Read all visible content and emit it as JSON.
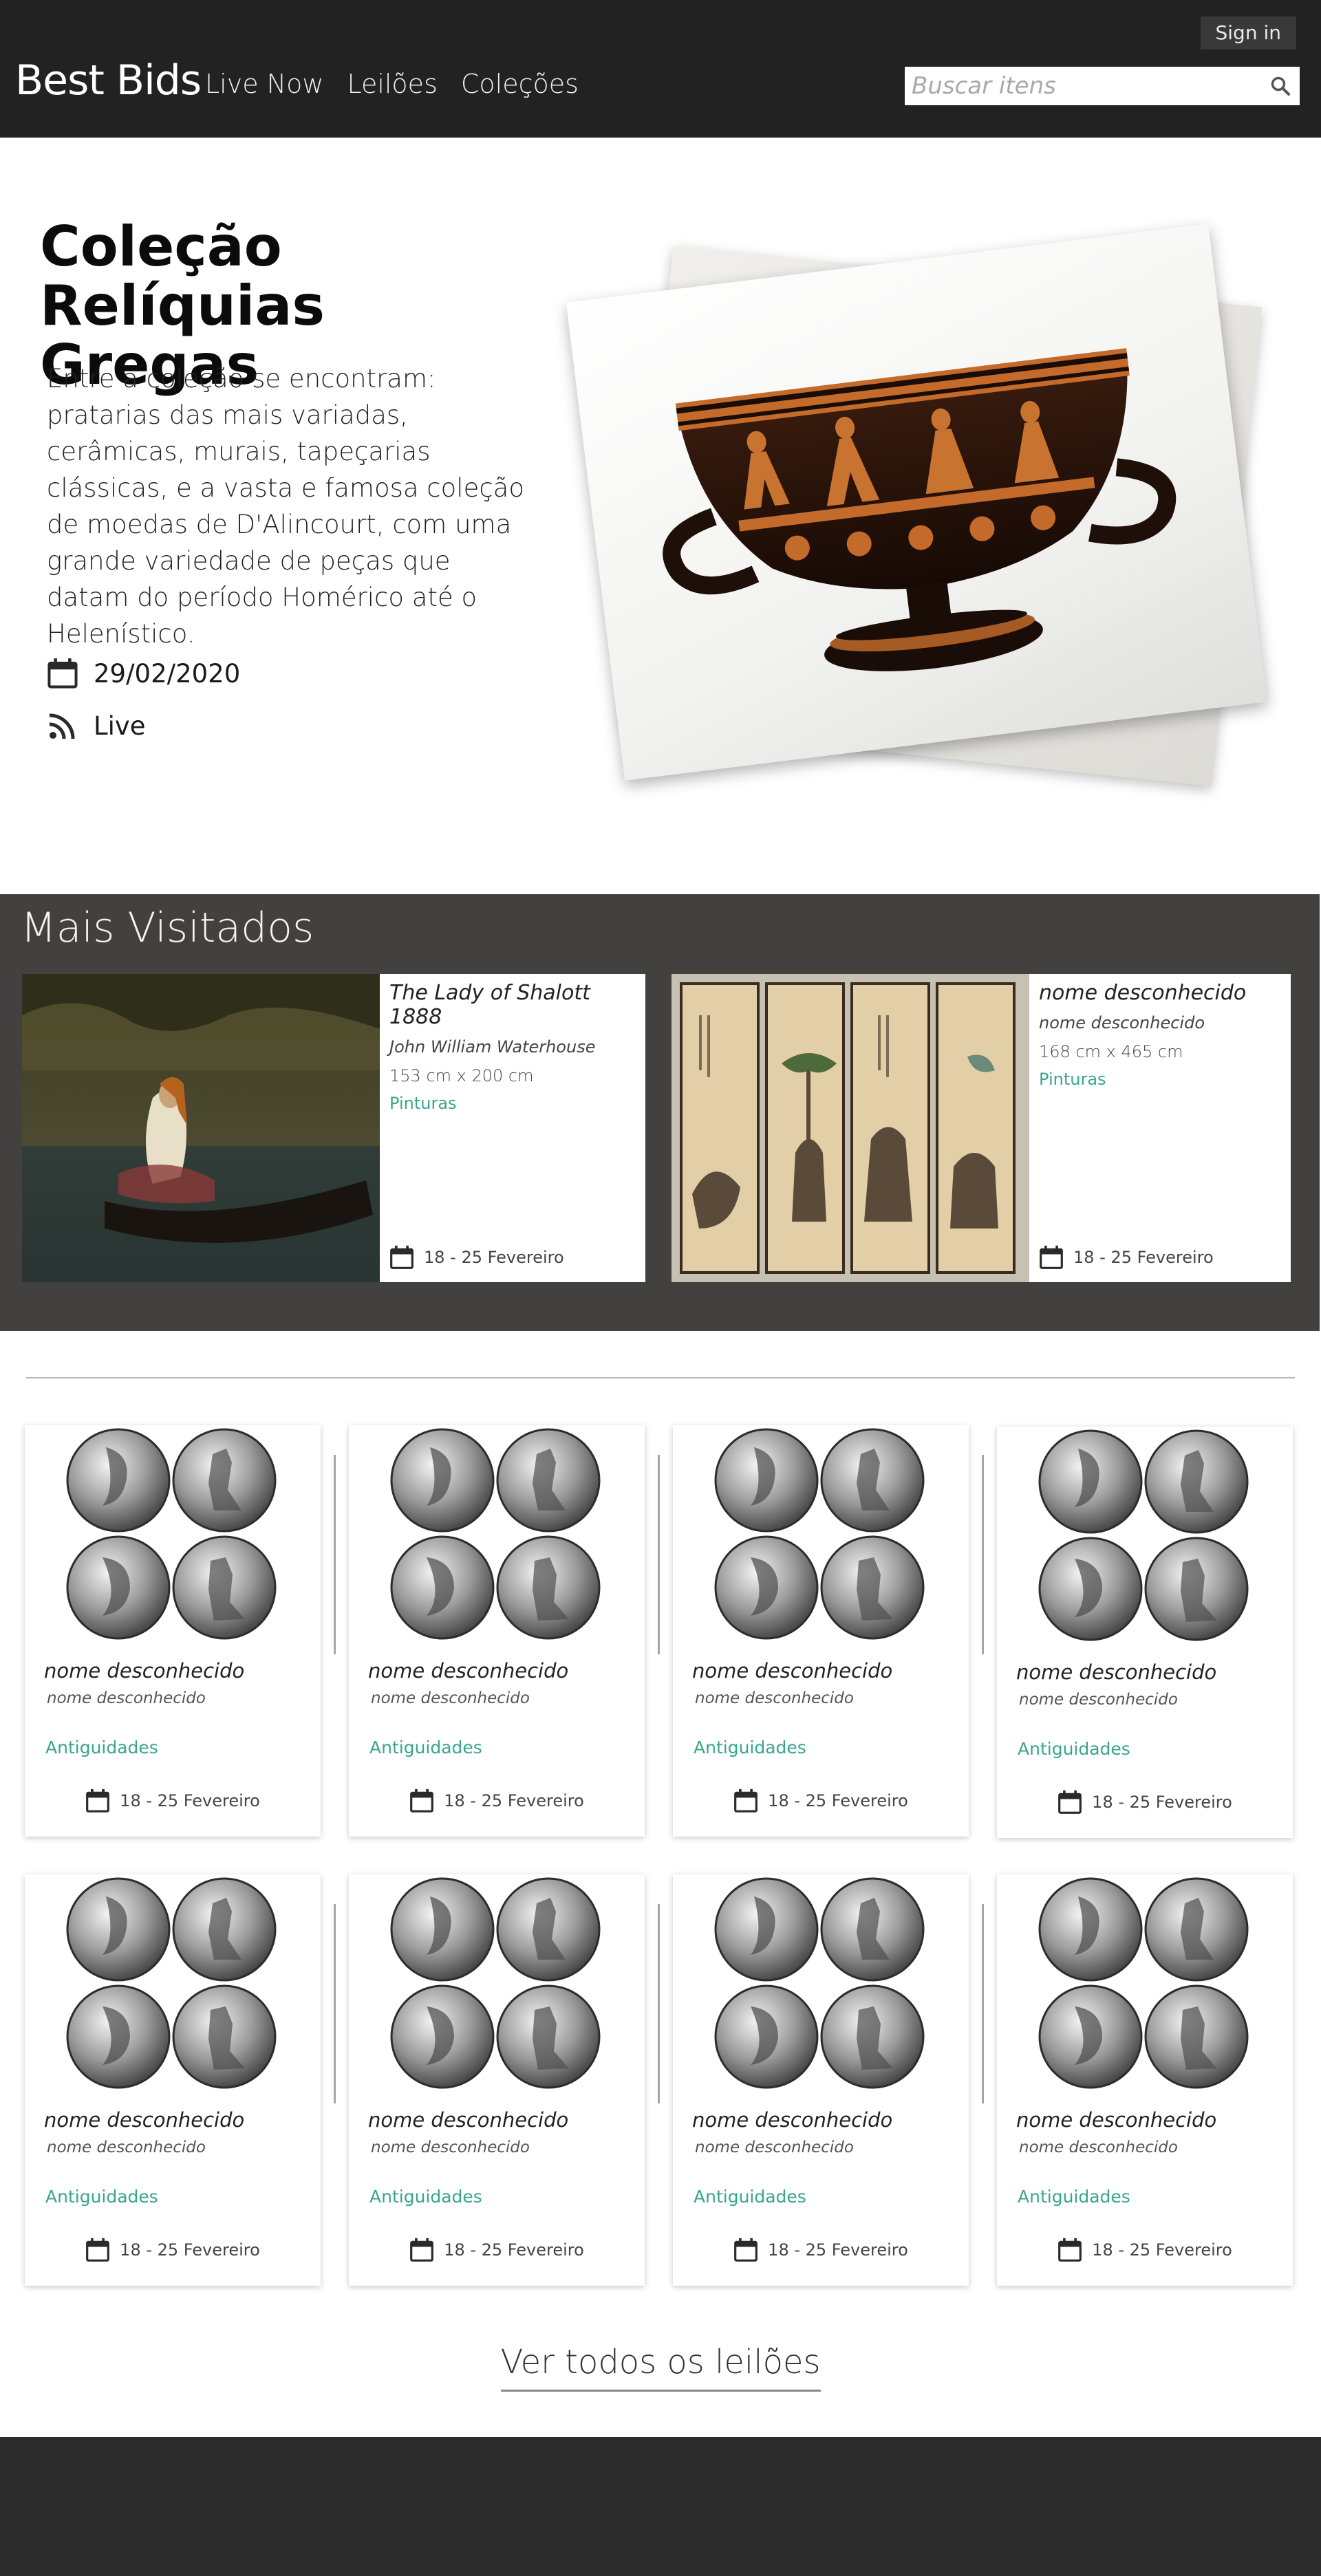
{
  "header": {
    "signin_label": "Sign in",
    "brand": "Best Bids",
    "nav": [
      "Live Now",
      "Leilões",
      "Coleções"
    ],
    "search_placeholder": "Buscar itens"
  },
  "hero": {
    "title_line1": "Coleção",
    "title_line2": "Relíquias Gregas",
    "description": "Entre a coleção se encontram: pratarias das mais variadas, cerâmicas, murais, tapeçarias clássicas, e a vasta e famosa coleção de moedas de D'Alincourt, com uma grande variedade de peças que datam do período Homérico até o Helenístico.",
    "date": "29/02/2020",
    "status": "Live"
  },
  "most_visited": {
    "heading": "Mais Visitados",
    "items": [
      {
        "title": "The Lady of Shalott 1888",
        "artist": "John William Waterhouse",
        "dimensions": "153 cm x 200 cm",
        "category": "Pinturas",
        "date": "18 - 25 Fevereiro"
      },
      {
        "title": "nome desconhecido",
        "artist": "nome desconhecido",
        "dimensions": "168 cm x 465 cm",
        "category": "Pinturas",
        "date": "18 - 25 Fevereiro"
      }
    ]
  },
  "grid": {
    "items": [
      {
        "title": "nome desconhecido",
        "subtitle": "nome desconhecido",
        "category": "Antiguidades",
        "date": "18 - 25 Fevereiro"
      },
      {
        "title": "nome desconhecido",
        "subtitle": "nome desconhecido",
        "category": "Antiguidades",
        "date": "18 - 25 Fevereiro"
      },
      {
        "title": "nome desconhecido",
        "subtitle": "nome desconhecido",
        "category": "Antiguidades",
        "date": "18 - 25 Fevereiro"
      },
      {
        "title": "nome desconhecido",
        "subtitle": "nome desconhecido",
        "category": "Antiguidades",
        "date": "18 - 25 Fevereiro"
      },
      {
        "title": "nome desconhecido",
        "subtitle": "nome desconhecido",
        "category": "Antiguidades",
        "date": "18 - 25 Fevereiro"
      },
      {
        "title": "nome desconhecido",
        "subtitle": "nome desconhecido",
        "category": "Antiguidades",
        "date": "18 - 25 Fevereiro"
      },
      {
        "title": "nome desconhecido",
        "subtitle": "nome desconhecido",
        "category": "Antiguidades",
        "date": "18 - 25 Fevereiro"
      },
      {
        "title": "nome desconhecido",
        "subtitle": "nome desconhecido",
        "category": "Antiguidades",
        "date": "18 - 25 Fevereiro"
      }
    ]
  },
  "see_all_label": "Ver todos os leilões",
  "colors": {
    "accent": "#3aa58d",
    "header_bg": "#232222",
    "section_bg": "#424140",
    "footer_bg": "#2c2c2c"
  },
  "icons": {
    "search": "search-icon",
    "calendar": "calendar-icon",
    "live": "rss-icon"
  }
}
